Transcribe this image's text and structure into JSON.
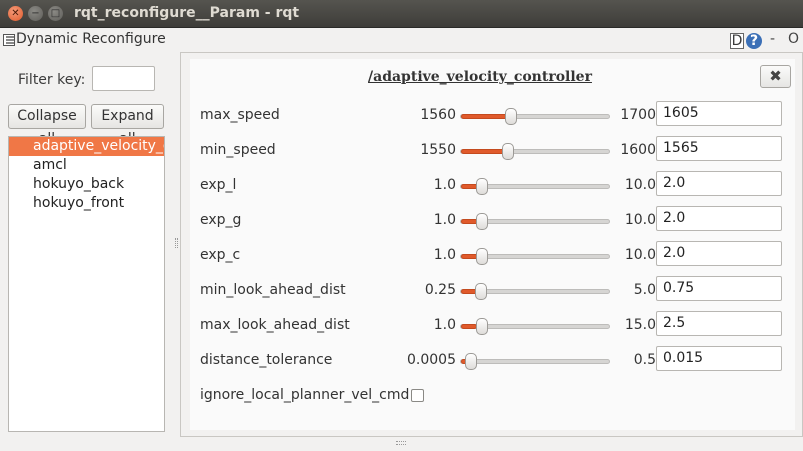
{
  "window": {
    "title": "rqt_reconfigure__Param - rqt",
    "buttons": [
      "✕",
      "−",
      "□"
    ]
  },
  "plugin": {
    "title": "Dynamic Reconfigure",
    "d_label": "D",
    "help_label": "?",
    "dash_label": "-",
    "o_label": "O"
  },
  "left": {
    "filter_label": "Filter key:",
    "filter_value": "",
    "collapse_label": "Collapse all",
    "expand_label": "Expand all",
    "nodes": [
      {
        "label": "adaptive_velocity_c",
        "selected": true
      },
      {
        "label": "amcl",
        "selected": false
      },
      {
        "label": "hokuyo_back",
        "selected": false
      },
      {
        "label": "hokuyo_front",
        "selected": false
      }
    ]
  },
  "right": {
    "node_title": "/adaptive_velocity_controller",
    "close_label": "✖",
    "params": [
      {
        "name": "max_speed",
        "min": "1560",
        "max": "1700",
        "value": "1605",
        "fraction": 0.32
      },
      {
        "name": "min_speed",
        "min": "1550",
        "max": "1600",
        "value": "1565",
        "fraction": 0.3
      },
      {
        "name": "exp_l",
        "min": "1.0",
        "max": "10.0",
        "value": "2.0",
        "fraction": 0.11
      },
      {
        "name": "exp_g",
        "min": "1.0",
        "max": "10.0",
        "value": "2.0",
        "fraction": 0.11
      },
      {
        "name": "exp_c",
        "min": "1.0",
        "max": "10.0",
        "value": "2.0",
        "fraction": 0.11
      },
      {
        "name": "min_look_ahead_dist",
        "min": "0.25",
        "max": "5.0",
        "value": "0.75",
        "fraction": 0.105
      },
      {
        "name": "max_look_ahead_dist",
        "min": "1.0",
        "max": "15.0",
        "value": "2.5",
        "fraction": 0.107
      },
      {
        "name": "distance_tolerance",
        "min": "0.0005",
        "max": "0.5",
        "value": "0.015",
        "fraction": 0.03
      }
    ],
    "bool_param": {
      "name": "ignore_local_planner_vel_cmd",
      "checked": false
    }
  },
  "colors": {
    "accent": "#f07746",
    "slider_fill": "#e05a2b",
    "titlebar": "#3e3d39"
  }
}
